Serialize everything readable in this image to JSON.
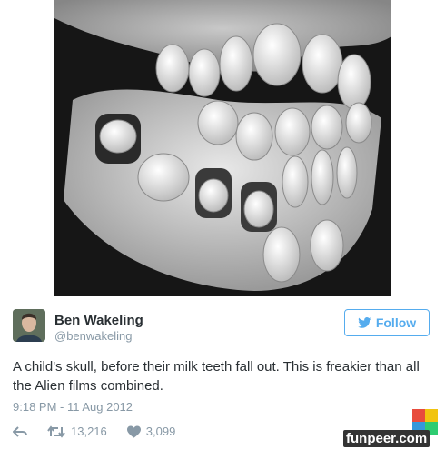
{
  "tweet": {
    "name": "Ben Wakeling",
    "handle": "@benwakeling",
    "follow_label": "Follow",
    "text": "A child's skull, before their milk teeth fall out. This is freakier than all the Alien films combined.",
    "time": "9:18 PM - 11 Aug 2012",
    "retweets": "13,216",
    "likes": "3,099"
  },
  "icons": {
    "reply": "reply-icon",
    "retweet": "retweet-icon",
    "like": "heart-icon",
    "follow": "bird-icon"
  },
  "watermark": {
    "text": "funpeer.com"
  },
  "colors": {
    "accent": "#55acee",
    "text": "#292f33",
    "muted": "#8899a6"
  }
}
